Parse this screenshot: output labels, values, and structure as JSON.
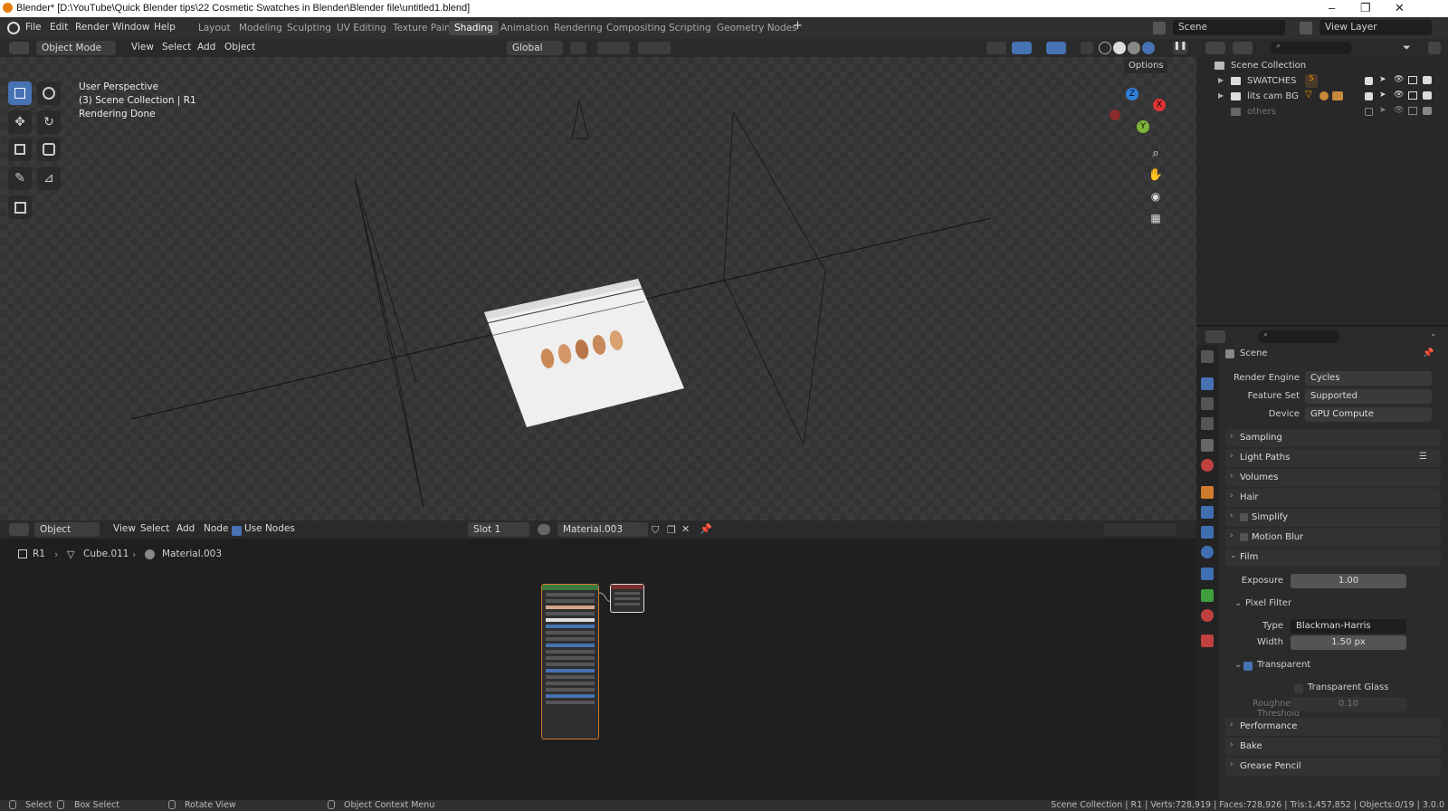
{
  "window": {
    "title": "Blender* [D:\\YouTube\\Quick Blender tips\\22 Cosmetic Swatches in Blender\\Blender file\\untitled1.blend]",
    "minimize": "–",
    "maximize": "❐",
    "close": "✕"
  },
  "menus": [
    "File",
    "Edit",
    "Render",
    "Window",
    "Help"
  ],
  "workspaces": [
    "Layout",
    "Modeling",
    "Sculpting",
    "UV Editing",
    "Texture Paint",
    "Shading",
    "Animation",
    "Rendering",
    "Compositing",
    "Scripting",
    "Geometry Nodes"
  ],
  "active_workspace": "Shading",
  "scene_name": "Scene",
  "view_layer": "View Layer",
  "viewport": {
    "mode": "Object Mode",
    "menus": [
      "View",
      "Select",
      "Add",
      "Object"
    ],
    "orientation": "Global",
    "options": "Options",
    "overlay_line1": "User Perspective",
    "overlay_line2": "(3) Scene Collection | R1",
    "overlay_line3": "Rendering Done",
    "gizmo": {
      "z": "Z",
      "y": "Y",
      "x": "X"
    }
  },
  "node_editor": {
    "mode": "Object",
    "menus": [
      "View",
      "Select",
      "Add",
      "Node"
    ],
    "use_nodes": "Use Nodes",
    "slot": "Slot 1",
    "material": "Material.003",
    "breadcrumb": [
      "R1",
      "Cube.011",
      "Material.003"
    ]
  },
  "outliner": {
    "root": "Scene Collection",
    "items": [
      {
        "name": "SWATCHES",
        "count": "5"
      },
      {
        "name": "lits cam BG",
        "count": ""
      },
      {
        "name": "others",
        "count": ""
      }
    ]
  },
  "properties": {
    "context": "Scene",
    "render_engine_label": "Render Engine",
    "render_engine": "Cycles",
    "feature_set_label": "Feature Set",
    "feature_set": "Supported",
    "device_label": "Device",
    "device": "GPU Compute",
    "panels_top": [
      "Sampling",
      "Light Paths",
      "Volumes",
      "Hair",
      "Simplify",
      "Motion Blur"
    ],
    "film": "Film",
    "exposure_label": "Exposure",
    "exposure": "1.00",
    "pixel_filter": "Pixel Filter",
    "type_label": "Type",
    "type": "Blackman-Harris",
    "width_label": "Width",
    "width": "1.50 px",
    "transparent": "Transparent",
    "transparent_glass": "Transparent Glass",
    "roughness_label": "Roughness Threshold",
    "roughness": "0.10",
    "panels_bottom": [
      "Performance",
      "Bake",
      "Grease Pencil"
    ]
  },
  "status": {
    "select": "Select",
    "box_select": "Box Select",
    "rotate": "Rotate View",
    "context_menu": "Object Context Menu",
    "stats": "Scene Collection | R1 | Verts:728,919 | Faces:728,926 | Tris:1,457,852 | Objects:0/19 | 3.0.0"
  },
  "colors": {
    "accent": "#4772b3",
    "header": "#303030",
    "panel": "#2b2b2b"
  }
}
